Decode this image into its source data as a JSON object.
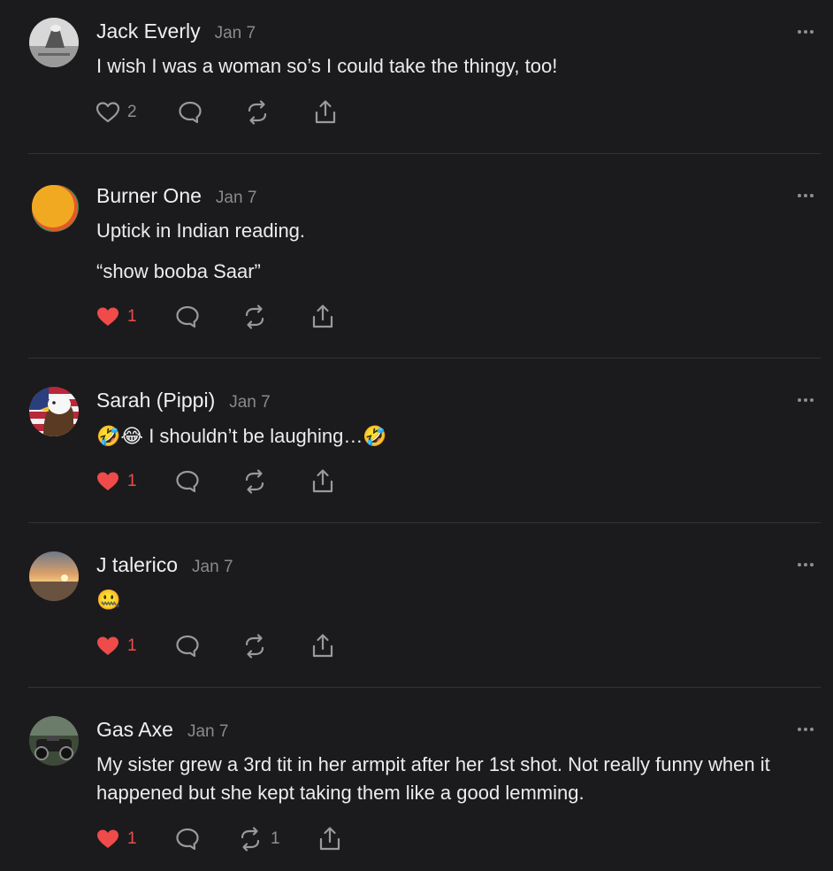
{
  "comments": [
    {
      "author": "Jack Everly",
      "date": "Jan 7",
      "text": [
        "I wish I was a woman so’s I could take the thingy, too!"
      ],
      "likes": "2",
      "liked": false,
      "restacks": ""
    },
    {
      "author": "Burner One",
      "date": "Jan 7",
      "text": [
        "Uptick in Indian reading.",
        "“show booba Saar”"
      ],
      "likes": "1",
      "liked": true,
      "restacks": ""
    },
    {
      "author": "Sarah (Pippi)",
      "date": "Jan 7",
      "text": [
        "🤣😂 I shouldn’t be laughing…🤣"
      ],
      "likes": "1",
      "liked": true,
      "restacks": ""
    },
    {
      "author": "J talerico",
      "date": "Jan 7",
      "text": [
        "🤐"
      ],
      "likes": "1",
      "liked": true,
      "restacks": ""
    },
    {
      "author": "Gas Axe",
      "date": "Jan 7",
      "text": [
        "My sister grew a 3rd tit in her armpit after her 1st shot. Not really funny when it happened but she kept taking them like a good lemming."
      ],
      "likes": "1",
      "liked": true,
      "restacks": "1"
    }
  ],
  "icons": {
    "like": "heart-icon",
    "reply": "comment-bubble-icon",
    "restack": "restack-icon",
    "share": "share-icon",
    "more": "more-dots-icon"
  },
  "colors": {
    "background": "#1b1b1d",
    "liked": "#ef4b4b",
    "muted": "#8e8e93",
    "text": "#ececec"
  }
}
